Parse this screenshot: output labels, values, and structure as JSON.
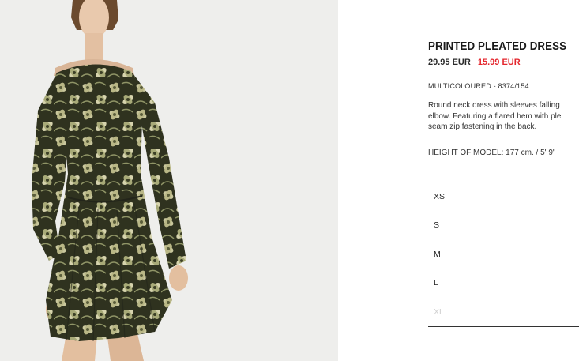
{
  "product": {
    "image_alt": "Model wearing printed pleated dress",
    "title": "PRINTED PLEATED DRESS",
    "old_price": "29.95 EUR",
    "sale_price": "15.99 EUR",
    "color_ref": "MULTICOLOURED - 8374/154",
    "description_lines": [
      "Round neck dress with sleeves falling",
      "elbow. Featuring a flared hem with ple",
      "seam zip fastening in the back."
    ],
    "model_height": "HEIGHT OF MODEL: 177 cm. / 5' 9\""
  },
  "sizes": [
    {
      "label": "XS",
      "available": true
    },
    {
      "label": "S",
      "available": true
    },
    {
      "label": "M",
      "available": true
    },
    {
      "label": "L",
      "available": true
    },
    {
      "label": "XL",
      "available": false
    }
  ],
  "colors": {
    "sale": "#e4262d",
    "dress_base": "#4d5236",
    "dress_flower": "#c9c79d",
    "background": "#eeeeec"
  }
}
